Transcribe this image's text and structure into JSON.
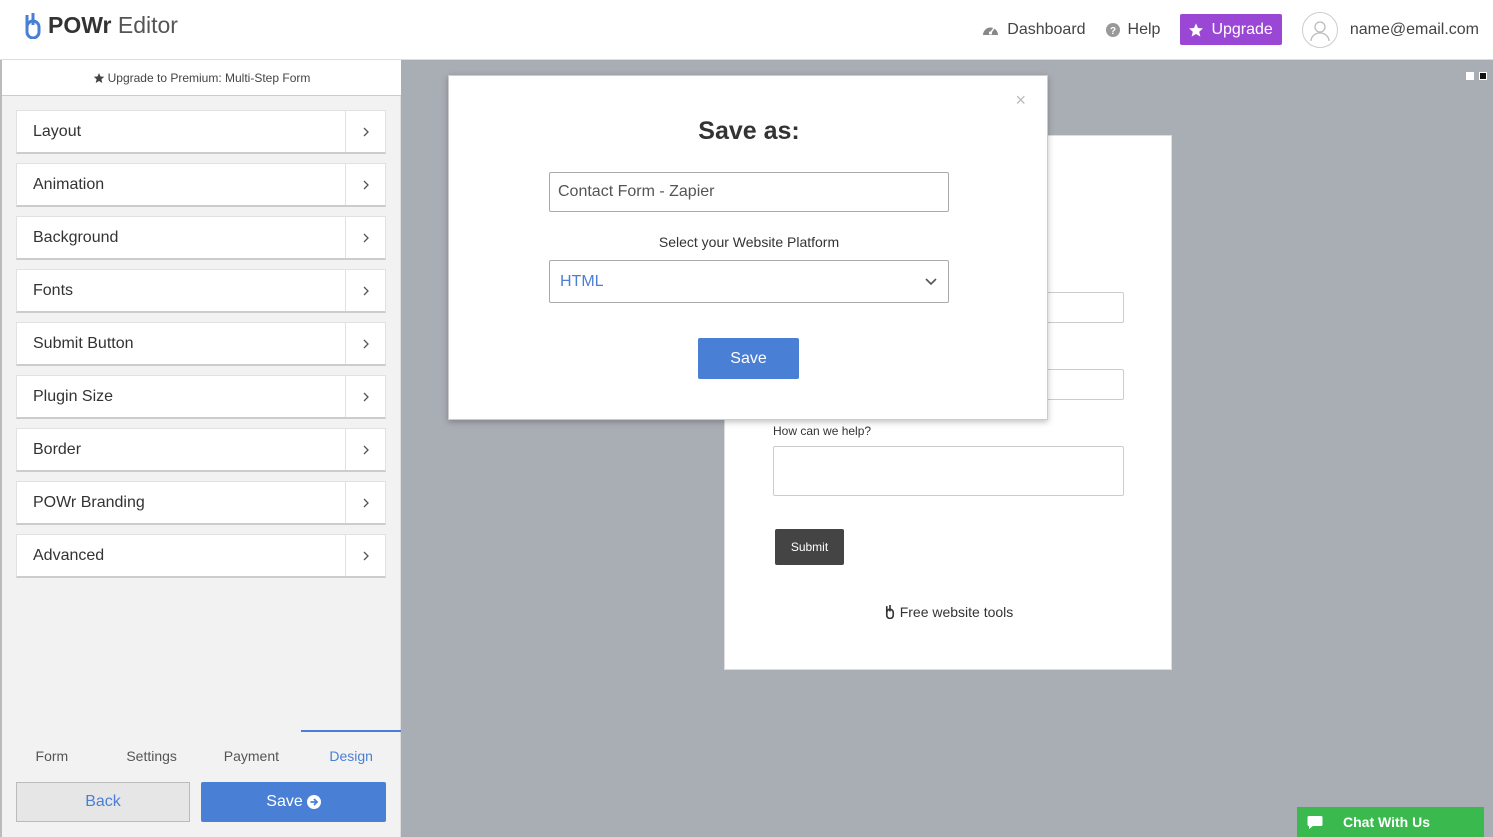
{
  "header": {
    "brand_bold": "POWr",
    "brand_light": "Editor",
    "dashboard": "Dashboard",
    "help": "Help",
    "upgrade": "Upgrade",
    "user_email": "name@email.com"
  },
  "sidebar": {
    "premium_text": "Upgrade to Premium: Multi-Step Form",
    "items": [
      {
        "label": "Layout"
      },
      {
        "label": "Animation"
      },
      {
        "label": "Background"
      },
      {
        "label": "Fonts"
      },
      {
        "label": "Submit Button"
      },
      {
        "label": "Plugin Size"
      },
      {
        "label": "Border"
      },
      {
        "label": "POWr Branding"
      },
      {
        "label": "Advanced"
      }
    ],
    "tabs": [
      "Form",
      "Settings",
      "Payment",
      "Design"
    ],
    "active_tab": "Design",
    "back_label": "Back",
    "save_label": "Save"
  },
  "preview": {
    "help_label": "How can we help?",
    "submit_label": "Submit",
    "tools_text": "Free website tools"
  },
  "modal": {
    "close": "×",
    "title": "Save as:",
    "name_value": "Contact Form - Zapier",
    "platform_label": "Select your Website Platform",
    "platform_value": "HTML",
    "save_label": "Save"
  },
  "chat": {
    "label": "Chat With Us"
  },
  "colors": {
    "accent": "#4a7fd6",
    "upgrade": "#9b47d6",
    "chat": "#3aba4e",
    "overlay": "#a9adb4"
  }
}
